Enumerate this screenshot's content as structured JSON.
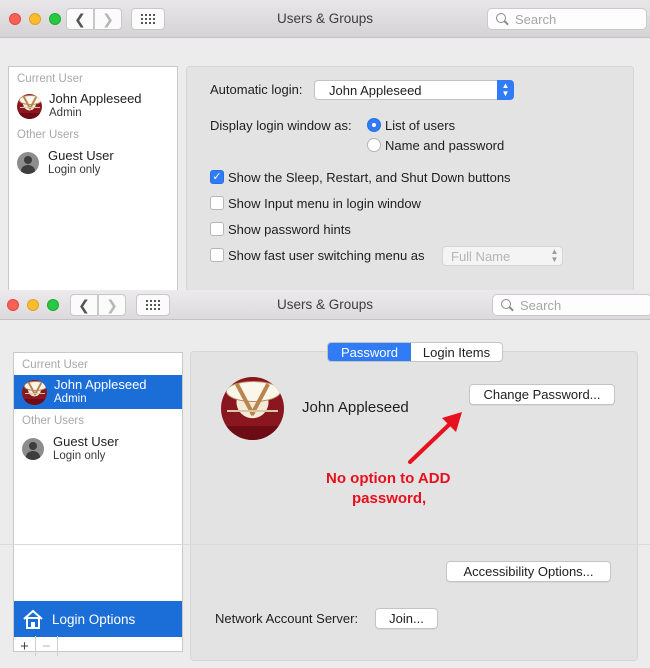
{
  "top": {
    "title": "Users & Groups",
    "search_placeholder": "Search",
    "sidebar": {
      "current_user_header": "Current User",
      "current_user": {
        "name": "John Appleseed",
        "role": "Admin"
      },
      "other_users_header": "Other Users",
      "guest": {
        "name": "Guest User",
        "role": "Login only"
      }
    },
    "login_options": {
      "automatic_login_label": "Automatic login:",
      "automatic_login_value": "John Appleseed",
      "display_login_label": "Display login window as:",
      "radio_list": "List of users",
      "radio_name": "Name and password",
      "check_sleep": "Show the Sleep, Restart, and Shut Down buttons",
      "check_input": "Show Input menu in login window",
      "check_hints": "Show password hints",
      "check_fast": "Show fast user switching menu as",
      "fast_value": "Full Name"
    }
  },
  "bottom": {
    "title": "Users & Groups",
    "search_placeholder": "Search",
    "sidebar": {
      "current_user_header": "Current User",
      "current_user": {
        "name": "John Appleseed",
        "role": "Admin"
      },
      "other_users_header": "Other Users",
      "guest": {
        "name": "Guest User",
        "role": "Login only"
      },
      "login_options": "Login Options",
      "add": "+",
      "remove": "−"
    },
    "tabs": {
      "password": "Password",
      "login_items": "Login Items"
    },
    "user_name": "John Appleseed",
    "change_password": "Change Password...",
    "annotation_line1": "No option to ADD",
    "annotation_line2": "password,",
    "accessibility": "Accessibility Options...",
    "network_label": "Network Account Server:",
    "join": "Join..."
  },
  "colors": {
    "accent": "#2f7cf6",
    "selection": "#1b6ed8",
    "annotation": "#e8101e"
  },
  "icons": [
    "back-arrow-icon",
    "forward-arrow-icon",
    "grid-icon",
    "search-icon",
    "drum-avatar-icon",
    "guest-user-icon",
    "house-icon",
    "red-arrow-annotation"
  ]
}
